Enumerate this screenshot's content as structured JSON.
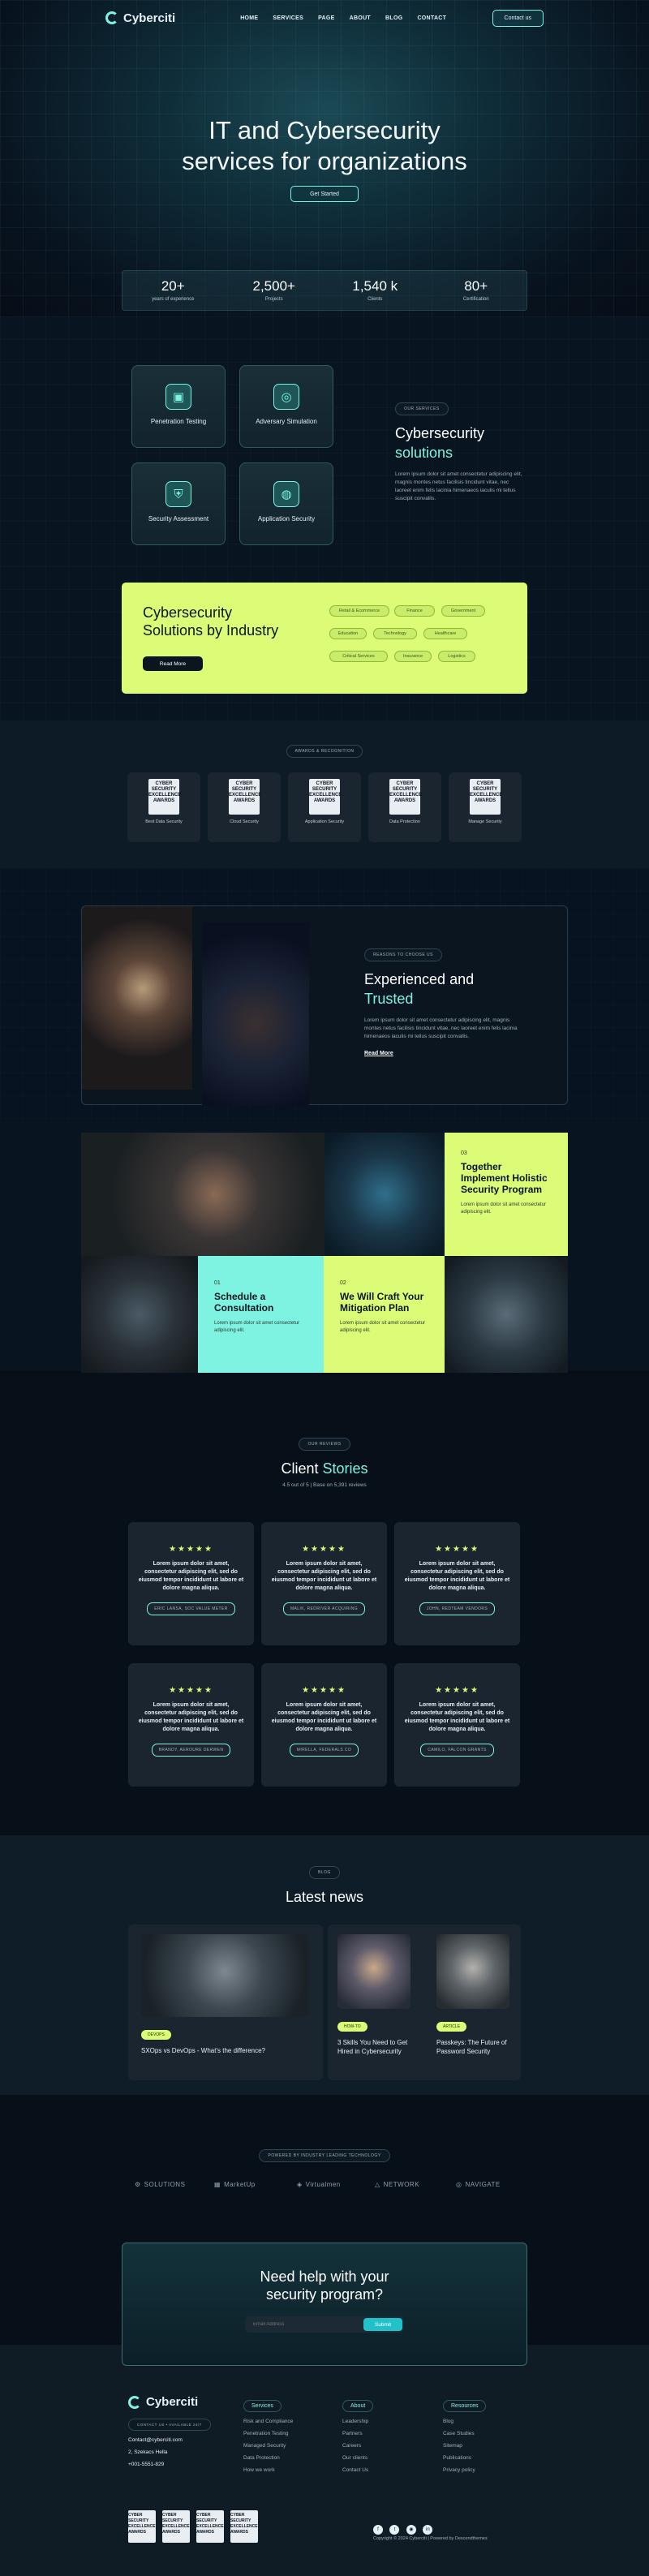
{
  "nav": {
    "brand": "Cyberciti",
    "links": [
      "HOME",
      "SERVICES",
      "PAGE",
      "ABOUT",
      "BLOG",
      "CONTACT"
    ],
    "contact_btn": "Contact us"
  },
  "hero": {
    "title_line1": "IT and Cybersecurity",
    "title_line2": "services for organizations",
    "cta": "Get Started"
  },
  "stats": [
    {
      "num": "20+",
      "label": "years of experience"
    },
    {
      "num": "2,500+",
      "label": "Projects"
    },
    {
      "num": "1,540 k",
      "label": "Clients"
    },
    {
      "num": "80+",
      "label": "Certification"
    }
  ],
  "services": {
    "pill": "OUR SERVICES",
    "title1": "Cybersecurity",
    "title2": "solutions",
    "text": "Lorem ipsum dolor sit amet consectetur adipiscing elit, magnis montes netus facilisis tincidunt vitae, nec laoreet enim felis lacinia himenaeos iaculis mi tellus suscipit convallis.",
    "cards": [
      "Penetration Testing",
      "Adversary Simulation",
      "Security Assessment",
      "Application Security"
    ]
  },
  "industry": {
    "title1": "Cybersecurity",
    "title2": "Solutions by Industry",
    "btn": "Read More",
    "tags": [
      "Retail & Ecommerce",
      "Finance",
      "Government",
      "Education",
      "Technology",
      "Healthcare",
      "Critical Services",
      "Insurance",
      "Logistics"
    ]
  },
  "awards": {
    "pill": "AWARDS & RECOGNITION",
    "badge_text": "CYBER SECURITY EXCELLENCE AWARDS",
    "items": [
      "Best Data Security",
      "Cloud Security",
      "Application Security",
      "Data Protection",
      "Manage Security"
    ]
  },
  "why": {
    "pill": "REASONS TO CHOOSE US",
    "title1": "Experienced and",
    "title2": "Trusted",
    "text": "Lorem ipsum dolor sit amet consectetur adipiscing elit, magnis montes netus facilisis tincidunt vitae, nec laoreet enim felis lacinia himenaeos iaculis mi tellus suscipit convallis.",
    "link": "Read More"
  },
  "steps": [
    {
      "n": "03",
      "title": "Together Implement Holistic Security Program",
      "text": "Lorem ipsum dolor sit amet consectetur adipiscing elit."
    },
    {
      "n": "01",
      "title": "Schedule a Consultation",
      "text": "Lorem ipsum dolor sit amet consectetur adipiscing elit."
    },
    {
      "n": "02",
      "title": "We Will Craft Your Mitigation Plan",
      "text": "Lorem ipsum dolor sit amet consectetur adipiscing elit."
    }
  ],
  "testimonials": {
    "pill": "OUR REVIEWS",
    "title1": "Client",
    "title2": "Stories",
    "sub": "4.5 out of 5 | Base on 5,391 reviews",
    "stars": "★★★★★",
    "quote": "Lorem ipsum dolor sit amet, consectetur adipiscing elit, sed do eiusmod tempor incididunt ut labore et dolore magna aliqua.",
    "names": [
      "ERIC LANSA, SOC VALUE METER",
      "MALIK, REDRIVER ACQUIRING",
      "JOHN, REDTEAM VENDORS",
      "BRANDY, AEROURE DERWEN",
      "MIRELLA, FEDERALS CO",
      "CAMILO, FALCON GRANTS"
    ]
  },
  "news": {
    "pill": "BLOG",
    "title": "Latest news",
    "items": [
      {
        "tag": "DEVOPS",
        "title": "SXOps vs DevOps - What's the difference?"
      },
      {
        "tag": "HOW-TO",
        "title": "3 Skills You Need to Get Hired in Cybersecurity"
      },
      {
        "tag": "ARTICLE",
        "title": "Passkeys: The Future of Password Security"
      }
    ]
  },
  "partners": {
    "pill": "POWERED BY INDUSTRY LEADING TECHNOLOGY",
    "items": [
      "SOLUTIONS",
      "MarketUp",
      "Virtualmen",
      "NETWORK",
      "NAVIGATE"
    ]
  },
  "cta": {
    "title1": "Need help with your",
    "title2": "security program?",
    "placeholder": "Email Address",
    "btn": "Submit"
  },
  "footer": {
    "brand": "Cyberciti",
    "badge": "CONTACT US • AVAILABLE 24/7",
    "email": "Contact@cyberciti.com",
    "address": "2, Szekacs Hella",
    "phone": "+001-5551-829",
    "cols": [
      {
        "title": "Services",
        "links": [
          "Risk and Compliance",
          "Penetration Testing",
          "Managed Security",
          "Data Protection",
          "How we work"
        ]
      },
      {
        "title": "About",
        "links": [
          "Leadership",
          "Partners",
          "Careers",
          "Our clients",
          "Contact Us"
        ]
      },
      {
        "title": "Resources",
        "links": [
          "Blog",
          "Case Studies",
          "Sitemap",
          "Publications",
          "Privacy policy"
        ]
      }
    ],
    "copyright": "Copyright © 2024 Cyberciti | Powered by Descendthemes"
  }
}
